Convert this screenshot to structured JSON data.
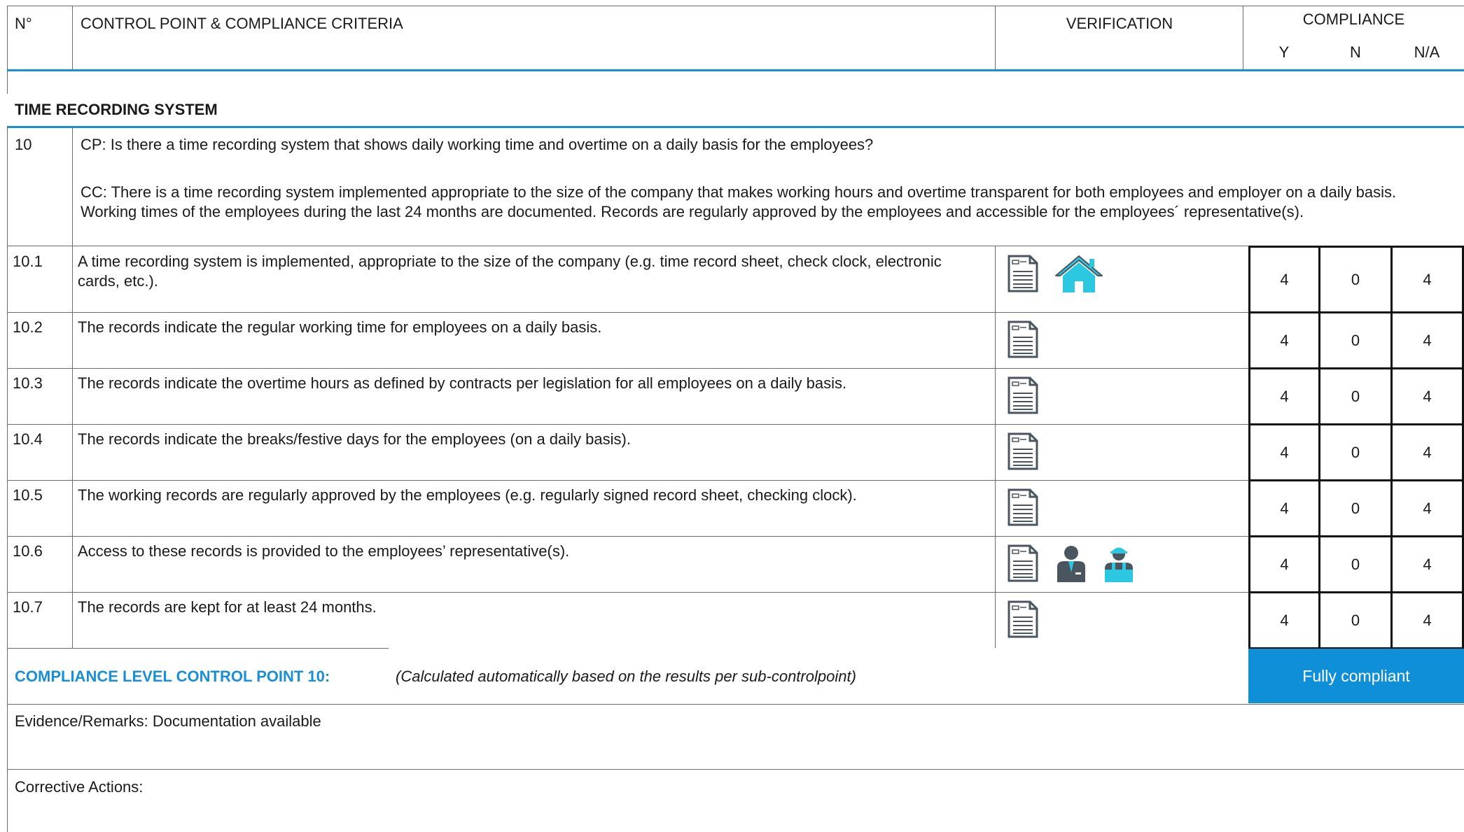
{
  "header": {
    "num": "N°",
    "criteria": "CONTROL POINT & COMPLIANCE CRITERIA",
    "verification": "VERIFICATION",
    "compliance": "COMPLIANCE",
    "y": "Y",
    "n": "N",
    "na": "N/A"
  },
  "section": {
    "title": "TIME RECORDING SYSTEM"
  },
  "control_point": {
    "num": "10",
    "cp": "CP: Is there a time recording system that shows daily working time and overtime on a daily basis for the employees?",
    "cc": "CC: There is a time recording system implemented appropriate to the size of the company that makes working hours and overtime transparent for both employees and employer on a daily basis. Working times of the employees during the last 24 months are documented. Records are regularly approved by the employees and accessible for the employees´ representative(s)."
  },
  "rows": [
    {
      "num": "10.1",
      "text": "A time recording system is implemented, appropriate to the size of the company (e.g. time record sheet, check clock, electronic cards, etc.).",
      "icons": [
        "document-icon",
        "house-icon"
      ],
      "y": "4",
      "n": "0",
      "na": "4"
    },
    {
      "num": "10.2",
      "text": "The records indicate the regular working time for employees on a daily basis.",
      "icons": [
        "document-icon"
      ],
      "y": "4",
      "n": "0",
      "na": "4"
    },
    {
      "num": "10.3",
      "text": "The records indicate the overtime hours as defined by contracts per legislation for all employees on a daily basis.",
      "icons": [
        "document-icon"
      ],
      "y": "4",
      "n": "0",
      "na": "4"
    },
    {
      "num": "10.4",
      "text": "The records indicate the breaks/festive days for the employees (on a daily basis).",
      "icons": [
        "document-icon"
      ],
      "y": "4",
      "n": "0",
      "na": "4"
    },
    {
      "num": "10.5",
      "text": "The working records are regularly approved by the employees (e.g. regularly signed record sheet, checking clock).",
      "icons": [
        "document-icon"
      ],
      "y": "4",
      "n": "0",
      "na": "4"
    },
    {
      "num": "10.6",
      "text": "Access to these records is provided to the employees’ representative(s).",
      "icons": [
        "document-icon",
        "manager-icon",
        "worker-icon"
      ],
      "y": "4",
      "n": "0",
      "na": "4"
    },
    {
      "num": "10.7",
      "text": "The records are kept for at least 24 months.",
      "icons": [
        "document-icon"
      ],
      "y": "4",
      "n": "0",
      "na": "4"
    }
  ],
  "summary": {
    "label": "COMPLIANCE LEVEL CONTROL POINT 10:",
    "note": "(Calculated automatically based on the results per sub-controlpoint)",
    "verdict": "Fully compliant"
  },
  "evidence": "Evidence/Remarks: Documentation available",
  "corrective": "Corrective Actions:",
  "colors": {
    "accent": "#1b8fd3",
    "verdict_bg": "#0f8fd7",
    "icon_dark": "#4a5560",
    "icon_cyan": "#2cc7e0"
  }
}
